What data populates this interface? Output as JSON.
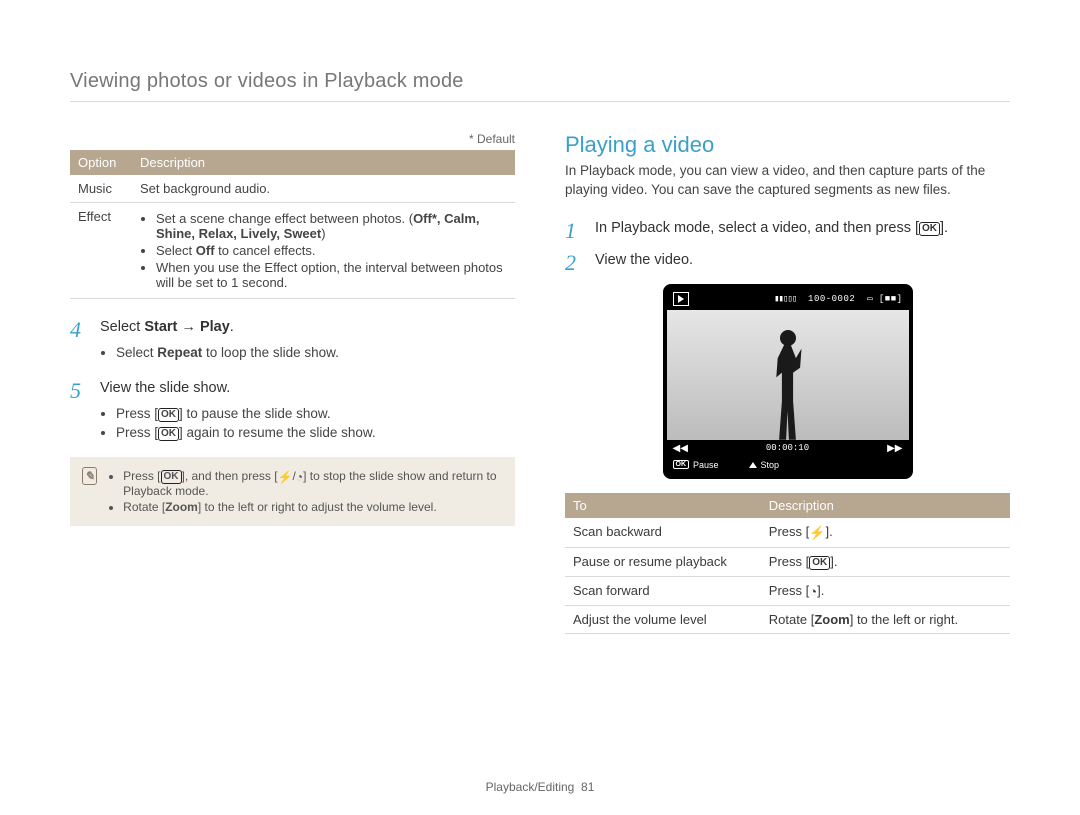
{
  "page_header": "Viewing photos or videos in Playback mode",
  "default_note": "* Default",
  "options_table": {
    "headers": [
      "Option",
      "Description"
    ],
    "rows": {
      "music": {
        "option": "Music",
        "desc": "Set background audio."
      },
      "effect": {
        "option": "Effect",
        "b1_pre": "Set a scene change effect between photos. (",
        "b1_bold": "Off*, Calm, Shine, Relax, Lively, Sweet",
        "b1_post": ")",
        "b2_pre": "Select ",
        "b2_bold": "Off",
        "b2_post": " to cancel effects.",
        "b3": "When you use the Effect option, the interval between photos will be set to 1 second."
      }
    }
  },
  "step4": {
    "num": "4",
    "pre": "Select ",
    "bold1": "Start",
    "arrow": " → ",
    "bold2": "Play",
    "post": "."
  },
  "step4_sub": {
    "pre": "Select ",
    "bold": "Repeat",
    "post": " to loop the slide show."
  },
  "step5": {
    "num": "5",
    "text": "View the slide show."
  },
  "step5_subs": {
    "a": {
      "pre": "Press [",
      "ok": "OK",
      "post": "] to pause the slide show."
    },
    "b": {
      "pre": "Press [",
      "ok": "OK",
      "post": "] again to resume the slide show."
    }
  },
  "info_box": {
    "a": {
      "pre": "Press [",
      "ok": "OK",
      "mid": "], and then press [",
      "flash": "⚡",
      "slash": "/",
      "timer": "◔",
      "post": "] to stop the slide show and return to Playback mode."
    },
    "b": {
      "pre": "Rotate [",
      "bold": "Zoom",
      "post": "] to the left or right to adjust the volume level."
    }
  },
  "right": {
    "heading": "Playing a video",
    "intro": "In Playback mode, you can view a video, and then capture parts of the playing video. You can save the captured segments as new files.",
    "step1": {
      "num": "1",
      "pre": "In Playback mode, select a video, and then press [",
      "ok": "OK",
      "post": "]."
    },
    "step2": {
      "num": "2",
      "text": "View the video."
    },
    "preview": {
      "top_right": "100-0002",
      "time": "00:00:10",
      "pause": "Pause",
      "stop": "Stop",
      "ok": "OK"
    },
    "controls_table": {
      "headers": [
        "To",
        "Description"
      ],
      "rows": {
        "r1": {
          "to": "Scan backward",
          "pre": "Press [",
          "icon": "⚡",
          "post": "]."
        },
        "r2": {
          "to": "Pause or resume playback",
          "pre": "Press [",
          "ok": "OK",
          "post": "]."
        },
        "r3": {
          "to": "Scan forward",
          "pre": "Press [",
          "icon": "◔",
          "post": "]."
        },
        "r4": {
          "to": "Adjust the volume level",
          "pre": "Rotate [",
          "bold": "Zoom",
          "post": "] to the left or right."
        }
      }
    }
  },
  "footer": {
    "section": "Playback/Editing",
    "page": "81"
  }
}
